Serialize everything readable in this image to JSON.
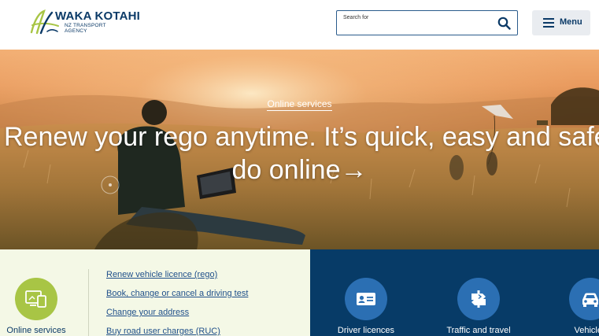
{
  "header": {
    "logo": {
      "title": "WAKA KOTAHI",
      "subtitle_line1": "NZ TRANSPORT",
      "subtitle_line2": "AGENCY"
    },
    "search": {
      "label": "Search for",
      "value": "",
      "icon": "search-icon"
    },
    "menu": {
      "label": "Menu",
      "icon": "hamburger-icon"
    }
  },
  "hero": {
    "eyebrow": "Online services",
    "title_line1": "Renew your rego anytime. It’s quick, easy and safe to",
    "title_line2": "do online→"
  },
  "services": {
    "label": "Online services",
    "icon": "online-services-icon",
    "links": [
      "Renew vehicle licence (rego)",
      "Book, change or cancel a driving test",
      "Change your address",
      "Buy road user charges (RUC)"
    ]
  },
  "categories": [
    {
      "label": "Driver licences",
      "icon": "driver-licence-icon"
    },
    {
      "label": "Traffic and travel",
      "icon": "traffic-sign-icon"
    },
    {
      "label": "Vehicles",
      "icon": "car-icon"
    }
  ],
  "colors": {
    "brand_navy": "#0b3a67",
    "brand_green": "#a8c545",
    "panel_blue": "#073b67",
    "circle_blue": "#2b6fb3",
    "link_blue": "#1f4f8a",
    "panel_cream": "#f4f8e6"
  }
}
